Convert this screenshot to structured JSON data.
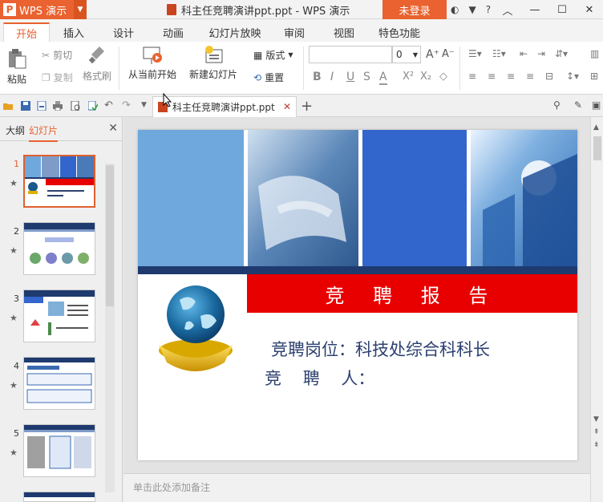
{
  "titlebar": {
    "app_name": "WPS 演示",
    "doc_title": "科主任竞聘演讲ppt.ppt - WPS 演示",
    "login": "未登录",
    "help": "?"
  },
  "tabs": [
    "开始",
    "插入",
    "设计",
    "动画",
    "幻灯片放映",
    "审阅",
    "视图",
    "特色功能"
  ],
  "ribbon": {
    "paste": "粘贴",
    "cut": "剪切",
    "copy": "复制",
    "format_painter": "格式刷",
    "from_current": "从当前开始",
    "new_slide": "新建幻灯片",
    "layout": "版式",
    "reset": "重置",
    "font_size": "0"
  },
  "doc_tab": {
    "name": "科主任竞聘演讲ppt.ppt"
  },
  "left_pane": {
    "tab_outline": "大纲",
    "tab_slides": "幻灯片",
    "thumbs": [
      "1",
      "2",
      "3",
      "4",
      "5"
    ]
  },
  "slide": {
    "title": "竞 聘 报 告",
    "line1": "竞聘岗位：科技处综合科科长",
    "line2": "竞    聘    人："
  },
  "notes": {
    "placeholder": "单击此处添加备注"
  },
  "colors": {
    "accent": "#e9622f",
    "title_red": "#e80000",
    "navy": "#1e3a6e"
  }
}
